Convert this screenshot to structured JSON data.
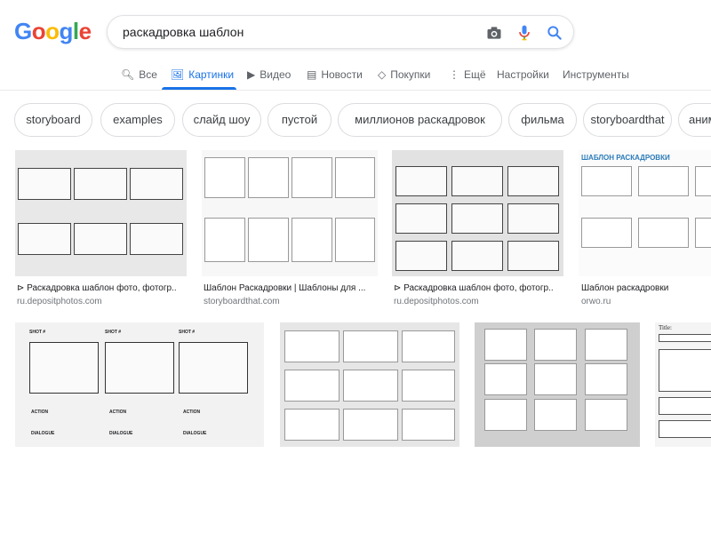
{
  "logo": [
    "G",
    "o",
    "o",
    "g",
    "l",
    "e"
  ],
  "logo_colors": [
    "#4285F4",
    "#EA4335",
    "#FBBC05",
    "#4285F4",
    "#34A853",
    "#EA4335"
  ],
  "search": {
    "query": "раскадровка шаблон"
  },
  "tabs": [
    {
      "label": "Все",
      "icon": "search-icon"
    },
    {
      "label": "Картинки",
      "icon": "image-icon",
      "active": true
    },
    {
      "label": "Видео",
      "icon": "video-icon"
    },
    {
      "label": "Новости",
      "icon": "news-icon"
    },
    {
      "label": "Покупки",
      "icon": "tag-icon"
    },
    {
      "label": "Ещё",
      "icon": "more-icon"
    },
    {
      "label": "Настройки"
    },
    {
      "label": "Инструменты"
    }
  ],
  "chips": [
    "storyboard",
    "examples",
    "слайд шоу",
    "пустой",
    "миллионов раскадровок",
    "фильма",
    "storyboardthat",
    "аним"
  ],
  "results_row1": [
    {
      "caption": "⊳ Раскадровка шаблон фото, фотогр...",
      "source": "ru.depositphotos.com"
    },
    {
      "caption": "Шаблон Раскадровки | Шаблоны для ...",
      "source": "storyboardthat.com"
    },
    {
      "caption": "⊳ Раскадровка шаблон фото, фотогр...",
      "source": "ru.depositphotos.com"
    },
    {
      "caption": "Шаблон раскадровки",
      "source": "orwo.ru"
    }
  ],
  "thumb_text": {
    "shablon_title": "ШАБЛОН РАСКАДРОВКИ",
    "shot": "SHOT #",
    "action": "ACTION",
    "dialogue": "DIALOGUE",
    "title": "Title:"
  },
  "colors": {
    "accent": "#1a73e8",
    "chip_border": "#dadce0"
  }
}
